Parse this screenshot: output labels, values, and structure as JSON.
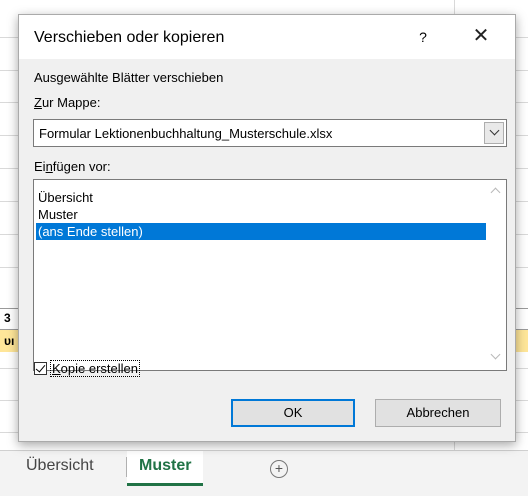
{
  "dialog": {
    "title": "Verschieben oder kopieren",
    "help_glyph": "?",
    "close_glyph": "✕",
    "instruction": "Ausgewählte Blätter verschieben",
    "workbook_label_key": "Z",
    "workbook_label_rest": "ur Mappe:",
    "workbook_value": "Formular Lektionenbuchhaltung_Musterschule.xlsx",
    "insert_before_pre": "Ei",
    "insert_before_key": "n",
    "insert_before_rest": "fügen vor:",
    "sheets": [
      {
        "label": "Übersicht",
        "selected": false
      },
      {
        "label": "Muster",
        "selected": false
      },
      {
        "label": "(ans Ende stellen)",
        "selected": true
      }
    ],
    "copy_checked": true,
    "copy_label_key": "K",
    "copy_label_rest": "opie erstellen",
    "ok_label": "OK",
    "cancel_label": "Abbrechen"
  },
  "background": {
    "row_fragment_a": "3",
    "row_fragment_b": "ᴜı"
  },
  "tabs": {
    "items": [
      {
        "label": "Übersicht",
        "active": false
      },
      {
        "label": "Muster",
        "active": true
      }
    ],
    "add_glyph": "+"
  },
  "colors": {
    "accent": "#0078d7",
    "excel_green": "#217346",
    "yellow_fill": "#ffe699"
  }
}
